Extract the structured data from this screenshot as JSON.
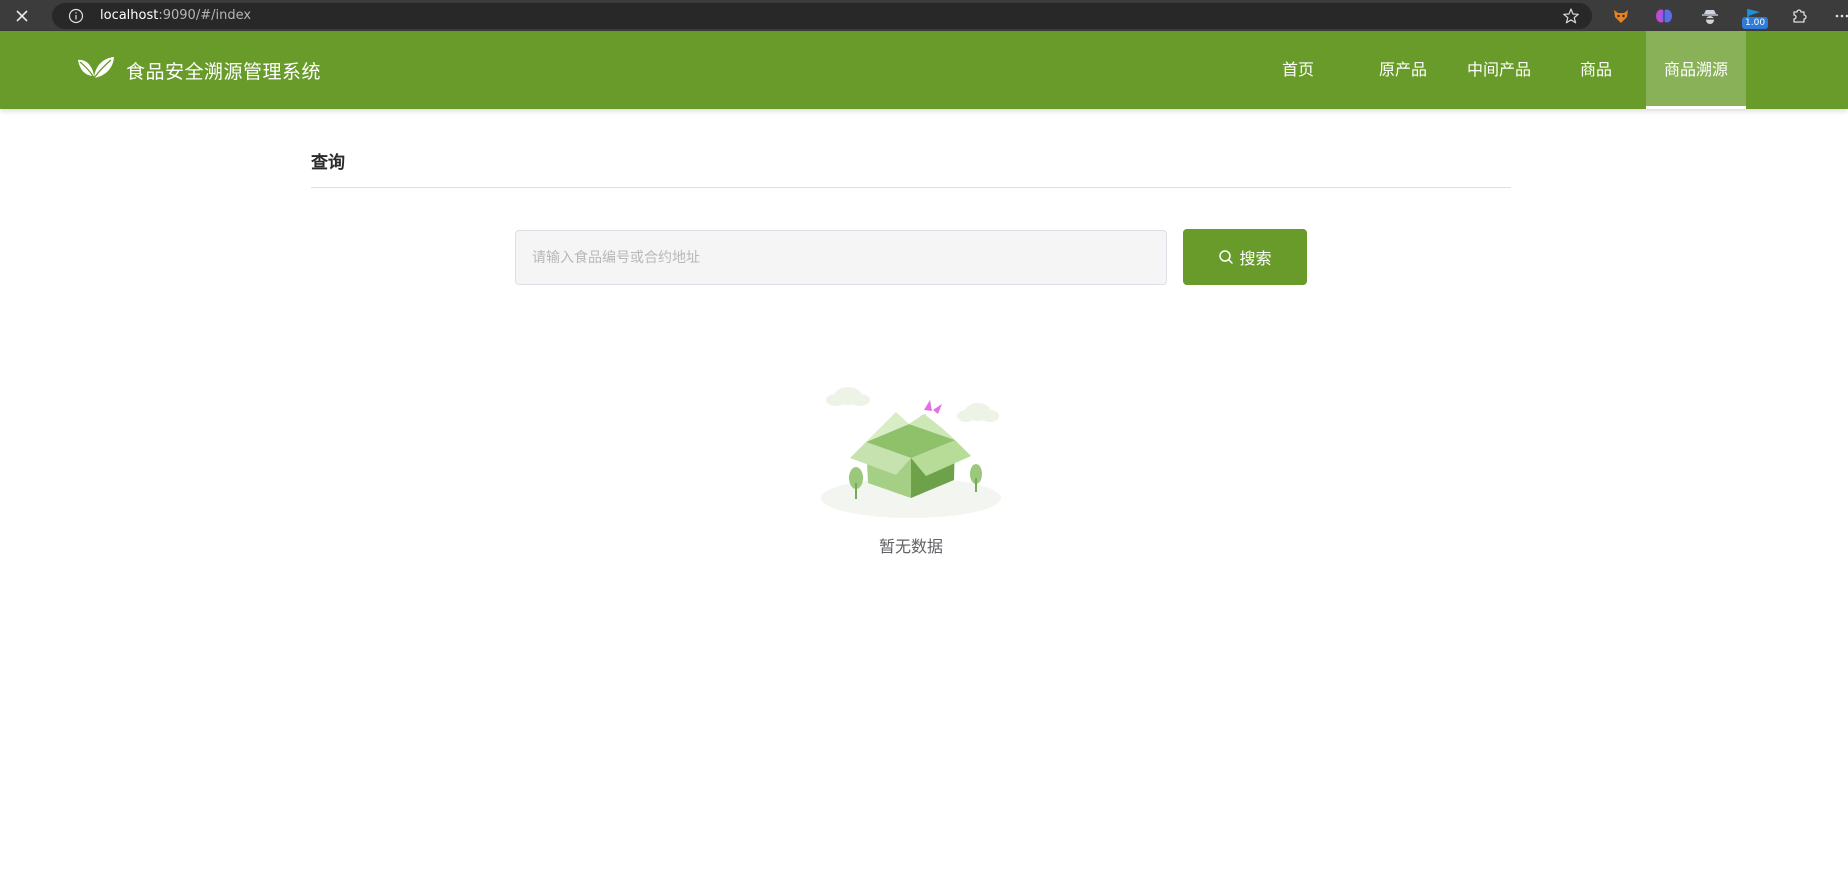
{
  "browser": {
    "url_host": "localhost",
    "url_rest": ":9090/#/index",
    "extension_badge": "1.00",
    "icons": [
      "close-icon",
      "info-icon",
      "star-icon",
      "fox-extension-icon",
      "brain-extension-icon",
      "spy-extension-icon",
      "flag-extension-icon",
      "puzzle-icon",
      "more-icon"
    ]
  },
  "app": {
    "title": "食品安全溯源管理系统",
    "brand_color": "#689b29"
  },
  "nav": {
    "items": [
      {
        "label": "首页"
      },
      {
        "label": "原产品"
      },
      {
        "label": "中间产品"
      },
      {
        "label": "商品"
      },
      {
        "label": "商品溯源",
        "active": true
      }
    ]
  },
  "query": {
    "section_title": "查询",
    "placeholder": "请输入食品编号或合约地址",
    "value": "",
    "button_label": "搜索"
  },
  "empty_state": {
    "text": "暂无数据"
  }
}
